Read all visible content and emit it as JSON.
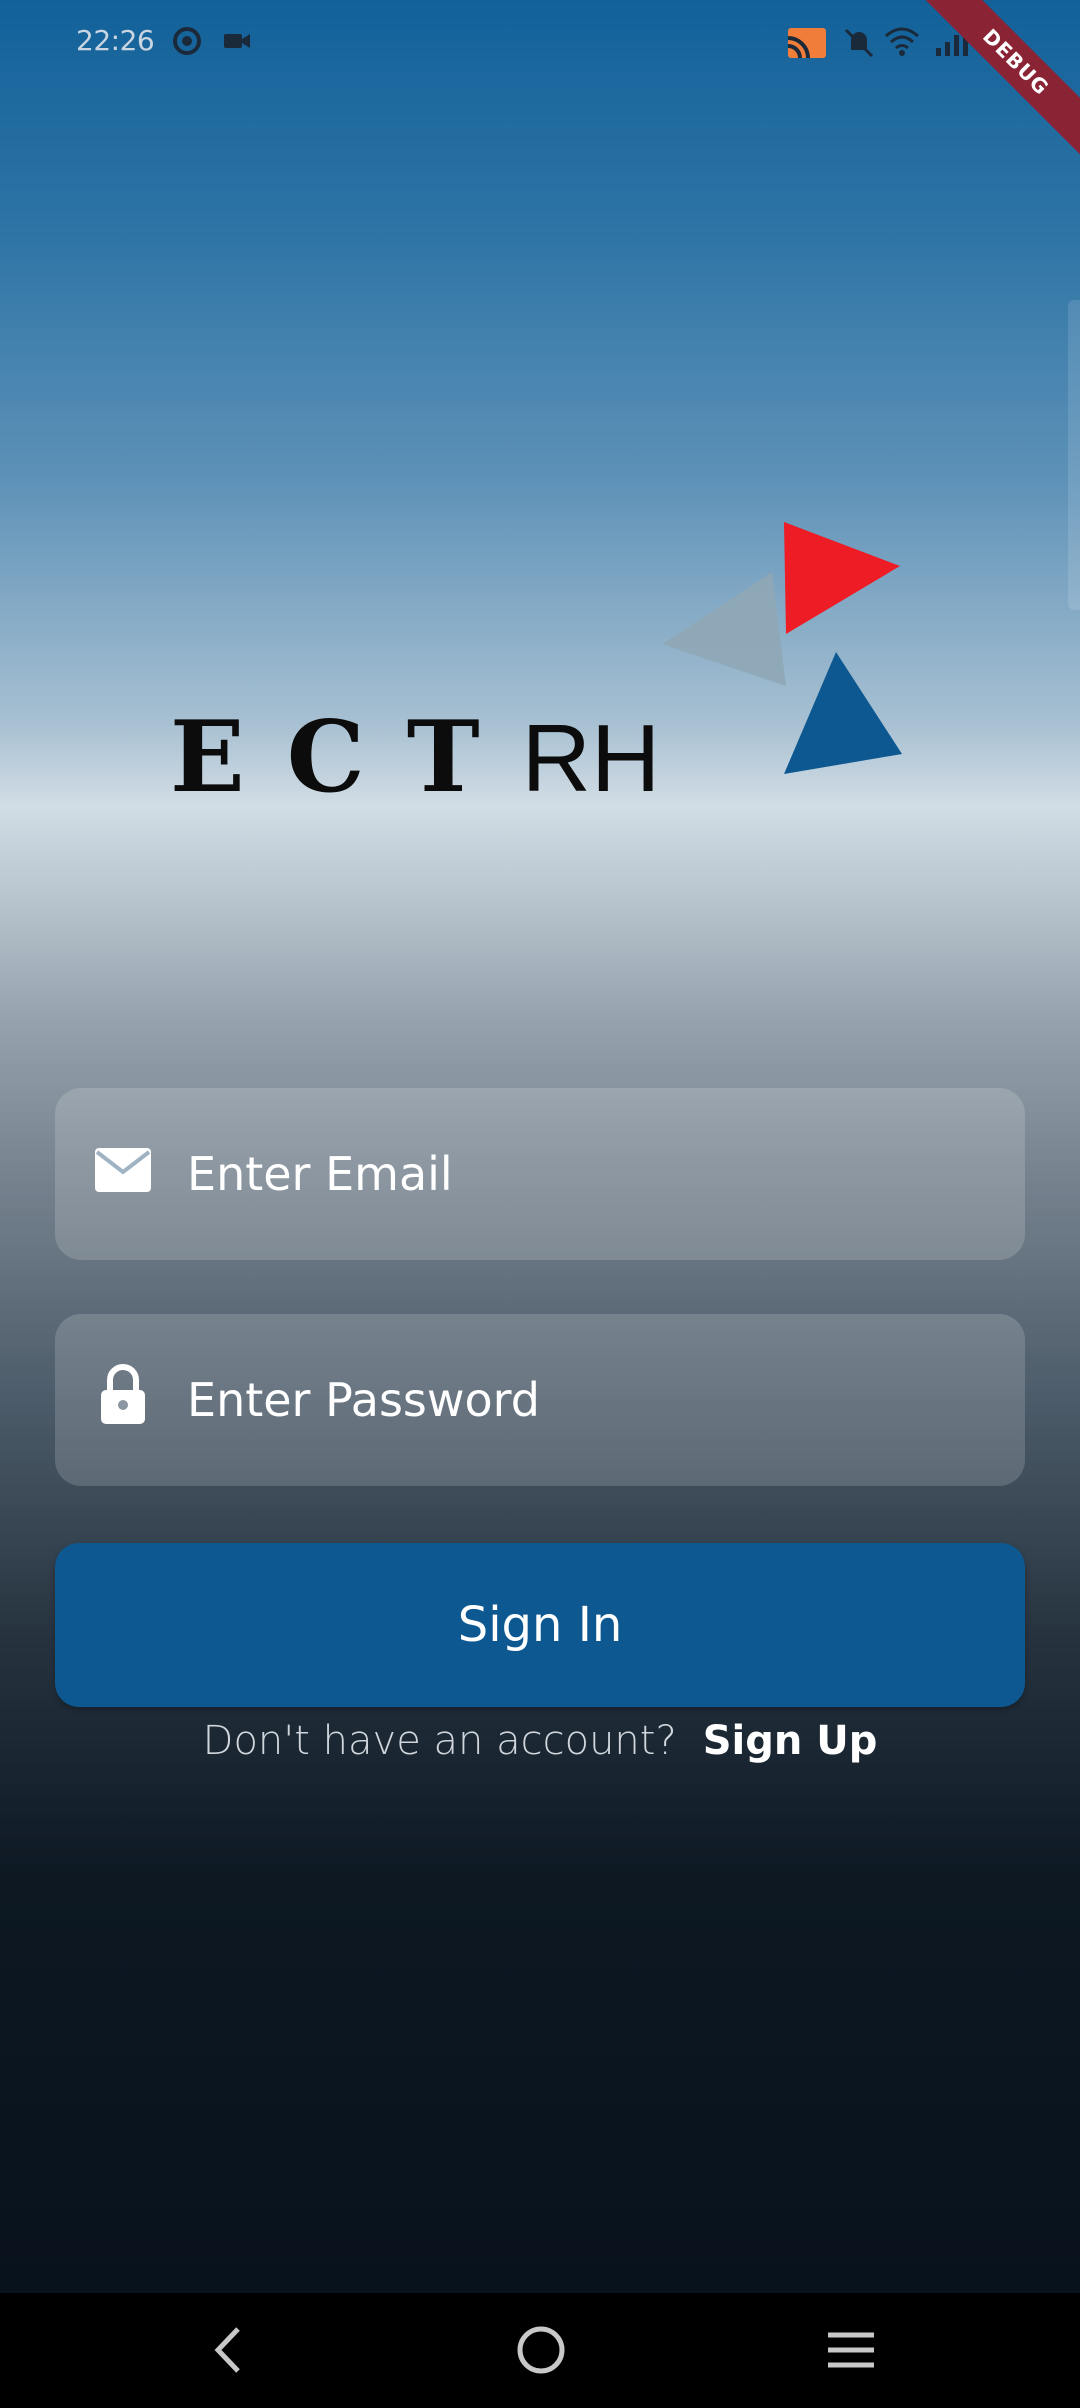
{
  "status_bar": {
    "time": "22:26",
    "icons": [
      "messenger-icon",
      "video-icon",
      "cast-icon",
      "bell-muted-icon",
      "wifi-icon",
      "signal-icon"
    ],
    "debug_banner": "DEBUG"
  },
  "logo": {
    "text_bold": [
      "E",
      "C",
      "T"
    ],
    "text_light": "RH",
    "colors": {
      "red": "#ee1c25",
      "grey": "#8fa7b6",
      "blue": "#0e5891"
    }
  },
  "form": {
    "email": {
      "placeholder": "Enter Email",
      "value": "",
      "icon": "mail-icon"
    },
    "password": {
      "placeholder": "Enter Password",
      "value": "",
      "icon": "lock-icon"
    },
    "signin_label": "Sign In",
    "signup_prompt": "Don't have an account?",
    "signup_link": "Sign Up"
  },
  "nav_bar": {
    "buttons": [
      "back-icon",
      "home-icon",
      "menu-icon"
    ]
  },
  "colors": {
    "accent": "#0e5891",
    "background_top": "#12619a",
    "background_bottom": "#07101a"
  }
}
